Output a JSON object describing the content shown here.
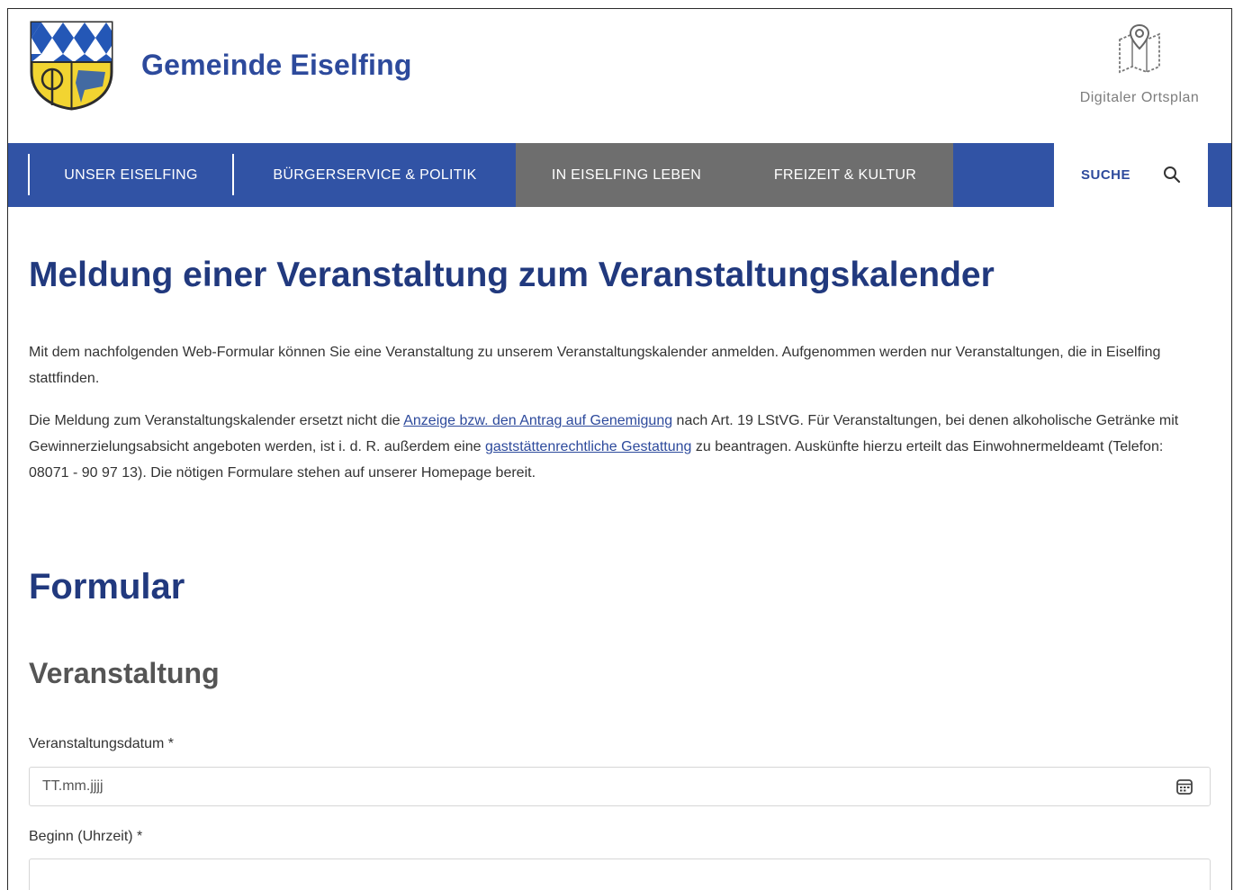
{
  "header": {
    "site_title": "Gemeinde Eiselfing",
    "ortsplan_label": "Digitaler Ortsplan",
    "ortsplan_icon": "map-pin-icon",
    "crest_icon": "coat-of-arms-icon"
  },
  "nav": {
    "items": [
      {
        "label": "UNSER EISELFING"
      },
      {
        "label": "BÜRGERSERVICE & POLITIK"
      },
      {
        "label": "IN EISELFING LEBEN"
      },
      {
        "label": "FREIZEIT & KULTUR"
      }
    ],
    "search_label": "SUCHE",
    "search_icon": "search-icon"
  },
  "colors": {
    "primary_blue": "#3153a5",
    "heading_blue": "#21397e",
    "nav_gray": "#6e6e6e"
  },
  "main": {
    "title": "Meldung einer Veranstaltung zum Veranstaltungskalender",
    "intro": "Mit dem nachfolgenden Web-Formular können Sie eine Veranstaltung zu unserem Veranstaltungskalender anmelden. Aufgenommen werden nur Veranstaltungen, die in Eiselfing stattfinden.",
    "para2": {
      "part1": "Die Meldung zum Veranstaltungskalender ersetzt nicht die ",
      "link1": "Anzeige bzw. den Antrag auf Genemigung",
      "part2": " nach Art. 19 LStVG. Für Veranstaltungen, bei denen alkoholische Getränke mit Gewinnerzielungsabsicht angeboten werden, ist i. d. R. außerdem eine ",
      "link2": "gaststättenrechtliche Gestattung",
      "part3": " zu beantragen. Auskünfte hierzu erteilt das Einwohnermeldeamt (Telefon: 08071 - 90 97 13). Die nötigen Formulare stehen auf unserer Homepage bereit."
    },
    "form_title": "Formular",
    "section_title": "Veranstaltung",
    "fields": [
      {
        "label": "Veranstaltungsdatum *",
        "placeholder": "TT.mm.jjjj",
        "icon": "calendar-icon"
      },
      {
        "label": "Beginn (Uhrzeit) *",
        "placeholder": ""
      }
    ]
  }
}
